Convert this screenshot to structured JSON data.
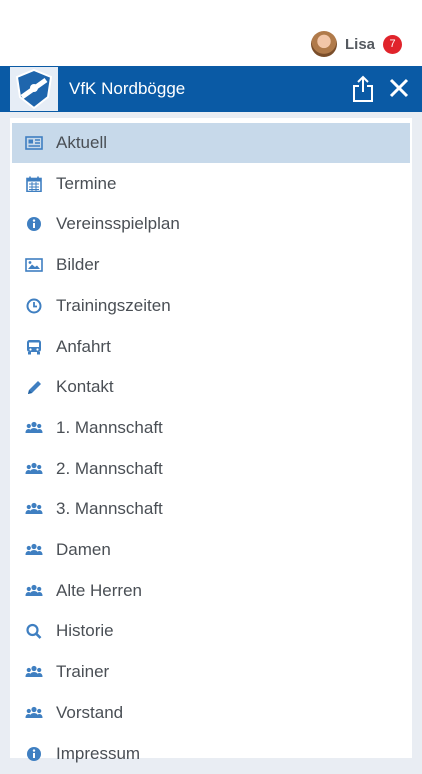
{
  "user": {
    "name": "Lisa",
    "badge": "7"
  },
  "header": {
    "title": "VfK Nordbögge"
  },
  "menu": [
    {
      "label": "Aktuell",
      "icon": "newspaper-icon",
      "active": true
    },
    {
      "label": "Termine",
      "icon": "calendar-icon"
    },
    {
      "label": "Vereinsspielplan",
      "icon": "info-icon"
    },
    {
      "label": "Bilder",
      "icon": "image-icon"
    },
    {
      "label": "Trainingszeiten",
      "icon": "clock-icon"
    },
    {
      "label": "Anfahrt",
      "icon": "bus-icon"
    },
    {
      "label": "Kontakt",
      "icon": "pencil-icon"
    },
    {
      "label": "1. Mannschaft",
      "icon": "group-icon"
    },
    {
      "label": "2. Mannschaft",
      "icon": "group-icon"
    },
    {
      "label": "3. Mannschaft",
      "icon": "group-icon"
    },
    {
      "label": "Damen",
      "icon": "group-icon"
    },
    {
      "label": "Alte Herren",
      "icon": "group-icon"
    },
    {
      "label": "Historie",
      "icon": "search-icon"
    },
    {
      "label": "Trainer",
      "icon": "group-icon"
    },
    {
      "label": "Vorstand",
      "icon": "group-icon"
    },
    {
      "label": "Impressum",
      "icon": "info-icon"
    }
  ],
  "colors": {
    "brand": "#0a5aa5",
    "icon": "#3f7fc1",
    "active_row": "#c7d9ea",
    "badge": "#e0232b"
  }
}
